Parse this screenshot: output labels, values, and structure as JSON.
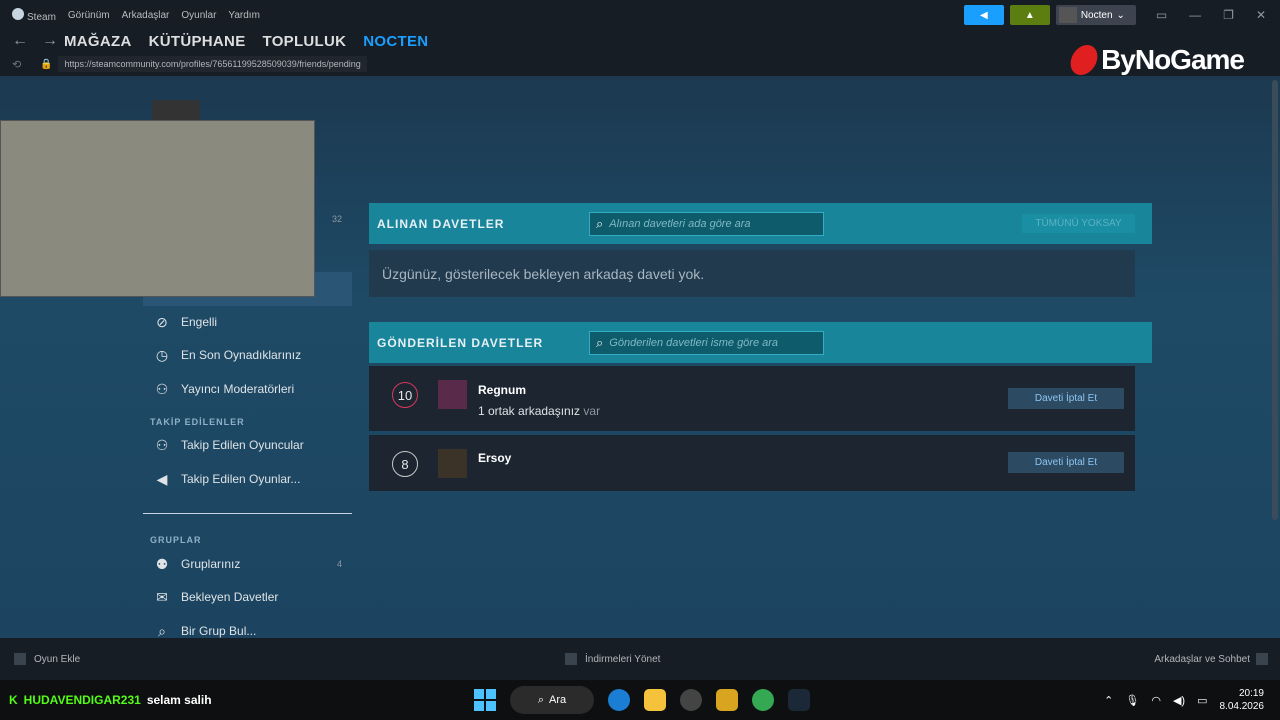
{
  "menu": {
    "steam": "Steam",
    "view": "Görünüm",
    "friends": "Arkadaşlar",
    "games": "Oyunlar",
    "help": "Yardım"
  },
  "account": {
    "username": "Nocten"
  },
  "nav": {
    "store": "MAĞAZA",
    "library": "KÜTÜPHANE",
    "community": "TOPLULUK",
    "profile": "NOCTEN"
  },
  "url": "https://steamcommunity.com/profiles/76561199528509039/friends/pending",
  "watermark": "ByNoGame",
  "sidebar": {
    "friend_count": "32",
    "items": [
      {
        "label": "Engelli",
        "icon": "block-icon"
      },
      {
        "label": "En Son Oynadıklarınız",
        "icon": "clock-icon"
      },
      {
        "label": "Yayıncı Moderatörleri",
        "icon": "person-icon"
      }
    ],
    "followed_header": "TAKİP EDİLENLER",
    "followed": [
      {
        "label": "Takip Edilen Oyuncular",
        "icon": "followed-players-icon"
      },
      {
        "label": "Takip Edilen Oyunlar...",
        "icon": "megaphone-icon"
      }
    ],
    "groups_header": "GRUPLAR",
    "groups": [
      {
        "label": "Gruplarınız",
        "count": "4",
        "icon": "groups-icon"
      },
      {
        "label": "Bekleyen Davetler",
        "icon": "mail-icon"
      },
      {
        "label": "Bir Grup Bul...",
        "icon": "search-icon"
      }
    ]
  },
  "received": {
    "title": "ALINAN DAVETLER",
    "search_placeholder": "Alınan davetleri ada göre ara",
    "ignore_all": "TÜMÜNÜ YOKSAY",
    "empty": "Üzgünüz, gösterilecek bekleyen arkadaş daveti yok."
  },
  "sent": {
    "title": "GÖNDERİLEN DAVETLER",
    "search_placeholder": "Gönderilen davetleri isme göre ara",
    "rows": [
      {
        "level": "10",
        "name": "Regnum",
        "mutual": "1 ortak arkadaşınız",
        "mutual_suffix": "var",
        "cancel": "Daveti İptal Et"
      },
      {
        "level": "8",
        "name": "Ersoy",
        "cancel": "Daveti İptal Et"
      }
    ]
  },
  "bottom": {
    "add_game": "Oyun Ekle",
    "downloads": "İndirmeleri Yönet",
    "friends_chat": "Arkadaşlar ve Sohbet"
  },
  "chat_overlay": {
    "user": "HUDAVENDIGAR231",
    "message": "selam salih"
  },
  "taskbar": {
    "search": "Ara",
    "time": "20:19",
    "date": "8.04.2026"
  },
  "colors": {
    "accent": "#1a9fff",
    "panel_header": "#19859a",
    "kick_green": "#53fc18"
  }
}
